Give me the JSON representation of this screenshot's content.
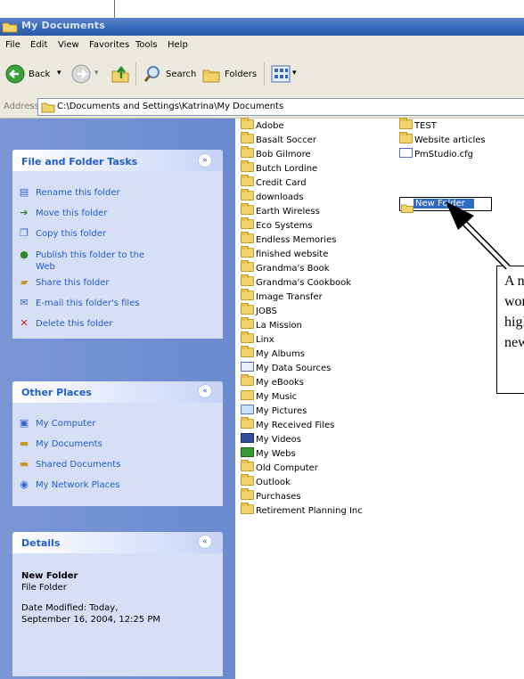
{
  "window": {
    "title": "My Documents"
  },
  "menu": [
    "File",
    "Edit",
    "View",
    "Favorites",
    "Tools",
    "Help"
  ],
  "toolbar": {
    "back": "Back",
    "search": "Search",
    "folders": "Folders"
  },
  "address": {
    "label": "Address",
    "path": "C:\\Documents and Settings\\Katrina\\My Documents"
  },
  "panels": {
    "file_folder_tasks": {
      "title": "File and Folder Tasks",
      "items": [
        "Rename this folder",
        "Move this folder",
        "Copy this folder",
        "Publish this folder to the",
        "Web",
        "Share this folder",
        "E-mail this folder's files",
        "Delete this folder"
      ]
    },
    "other_places": {
      "title": "Other Places",
      "items": [
        "My Computer",
        "My Documents",
        "Shared Documents",
        "My Network Places"
      ]
    },
    "details": {
      "title": "Details",
      "name": "New Folder",
      "type": "File Folder",
      "modified_line1": "Date Modified: Today,",
      "modified_line2": "September 16, 2004, 12:25 PM"
    }
  },
  "files_col1": [
    "Adobe",
    "Basalt Soccer",
    "Bob Gilmore",
    "Butch Lordine",
    "Credit Card",
    "downloads",
    "Earth Wireless",
    "Eco Systems",
    "Endless Memories",
    "finished website",
    "Grandma's Book",
    "Grandma's Cookbook",
    "Image Transfer",
    "JOBS",
    "La Mission",
    "Linx",
    "My Albums",
    "My Data Sources",
    "My eBooks",
    "My Music",
    "My Pictures",
    "My Received Files",
    "My Videos",
    "My Webs",
    "Old Computer",
    "Outlook",
    "Purchases",
    "Retirement Planning Inc"
  ],
  "files_col2": [
    "TEST",
    "Website articles",
    "PmStudio.cfg"
  ],
  "new_folder_edit": "New Folder",
  "callout": {
    "lines": [
      "A n",
      "wor",
      "higl",
      "new"
    ]
  },
  "colors": {
    "title_bar": "#3466b8",
    "task_link": "#215dc6",
    "selection": "#316ac5"
  }
}
